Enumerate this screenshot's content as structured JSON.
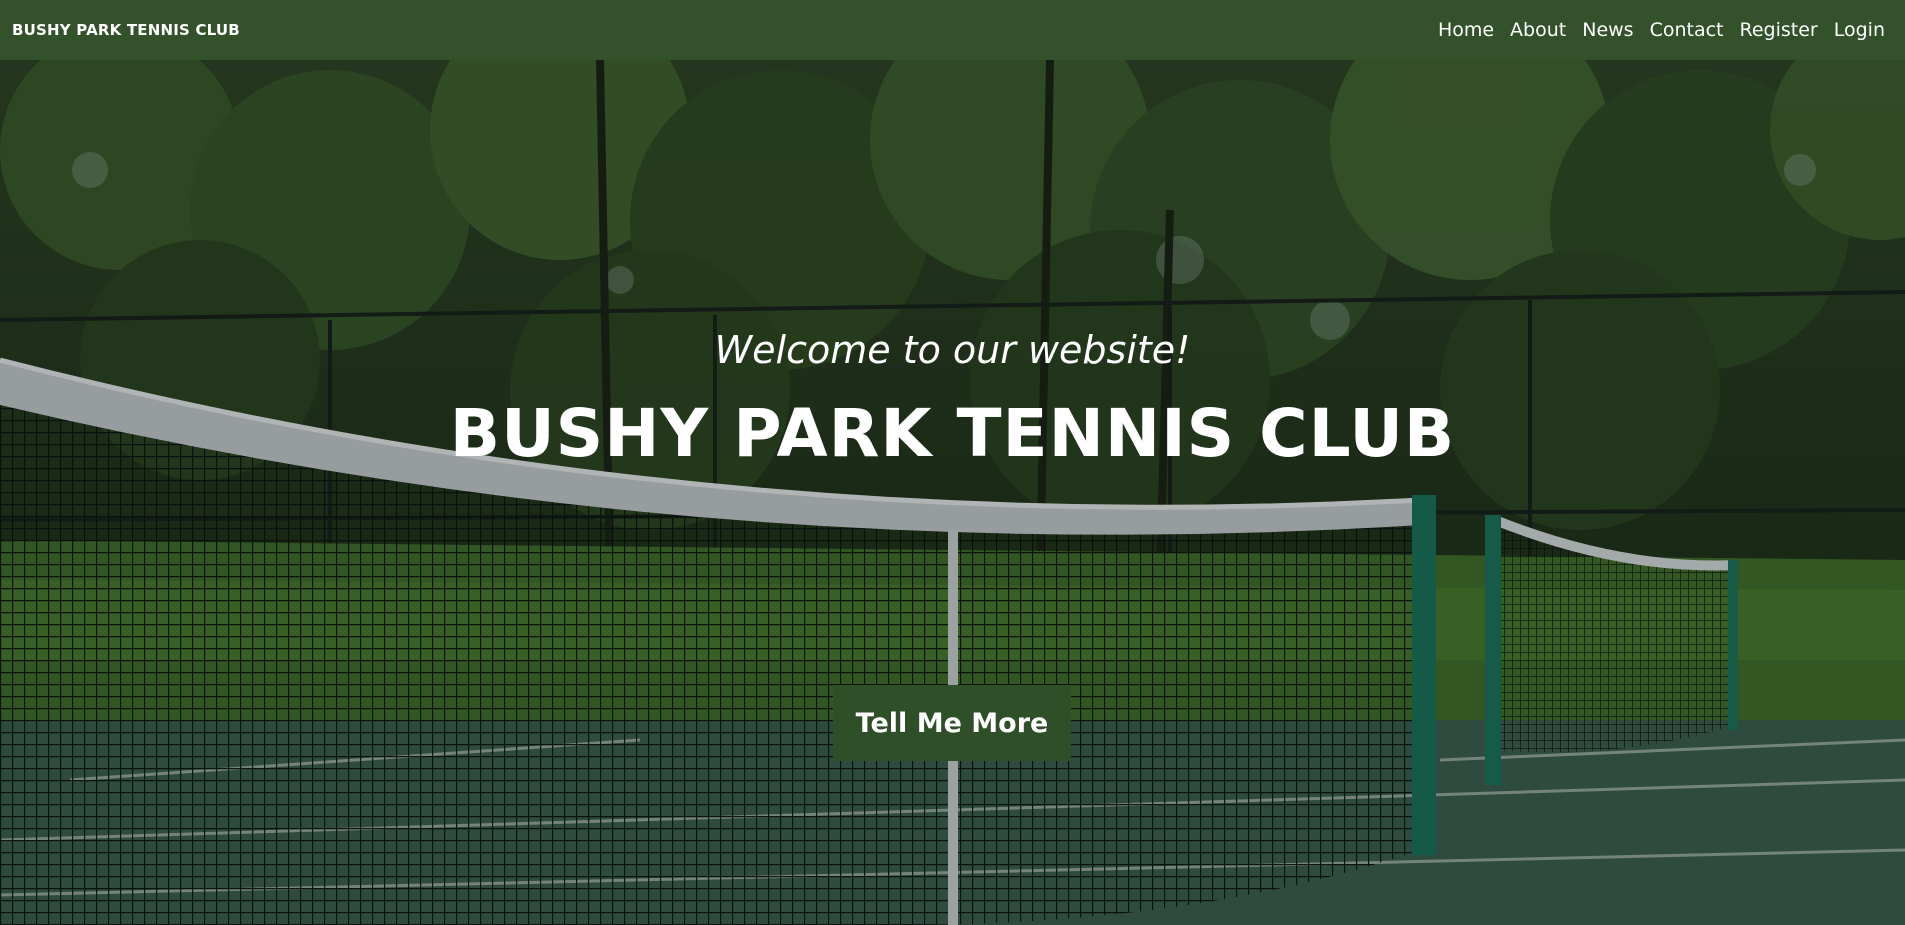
{
  "navbar": {
    "brand": "BUSHY PARK TENNIS CLUB",
    "links": [
      {
        "label": "Home"
      },
      {
        "label": "About"
      },
      {
        "label": "News"
      },
      {
        "label": "Contact"
      },
      {
        "label": "Register"
      },
      {
        "label": "Login"
      }
    ],
    "background_color": "#33522b"
  },
  "hero": {
    "welcome_text": "Welcome to our website!",
    "title": "BUSHY PARK TENNIS CLUB",
    "cta_label": "Tell Me More",
    "cta_color": "#2f4f28",
    "background_image": "tennis-court-net-photo"
  }
}
